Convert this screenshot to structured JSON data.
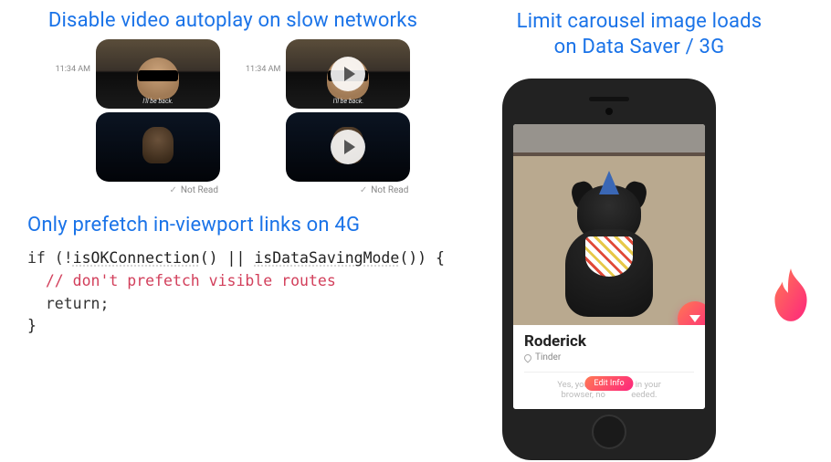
{
  "headings": {
    "autoplay": "Disable video autoplay on slow networks",
    "carousel_line1": "Limit carousel image loads",
    "carousel_line2": "on Data Saver / 3G",
    "prefetch": "Only prefetch in-viewport links on 4G"
  },
  "messaging": {
    "timestamp": "11:34 AM",
    "caption": "I'll be back.",
    "status": "Not Read"
  },
  "code": {
    "line1_a": "if (!",
    "line1_b": "isOKConnection",
    "line1_c": "() || ",
    "line1_d": "isDataSavingMode",
    "line1_e": "()) {",
    "line2": "  // don't prefetch visible routes",
    "line3": "  return;",
    "line4": "}"
  },
  "tinder": {
    "name": "Roderick",
    "subline": "Tinder",
    "hint_left": "Yes, you can",
    "hint_right": "in your",
    "hint_line2": "browser, no",
    "hint_line2b": "eeded.",
    "edit_button": "Edit Info"
  }
}
